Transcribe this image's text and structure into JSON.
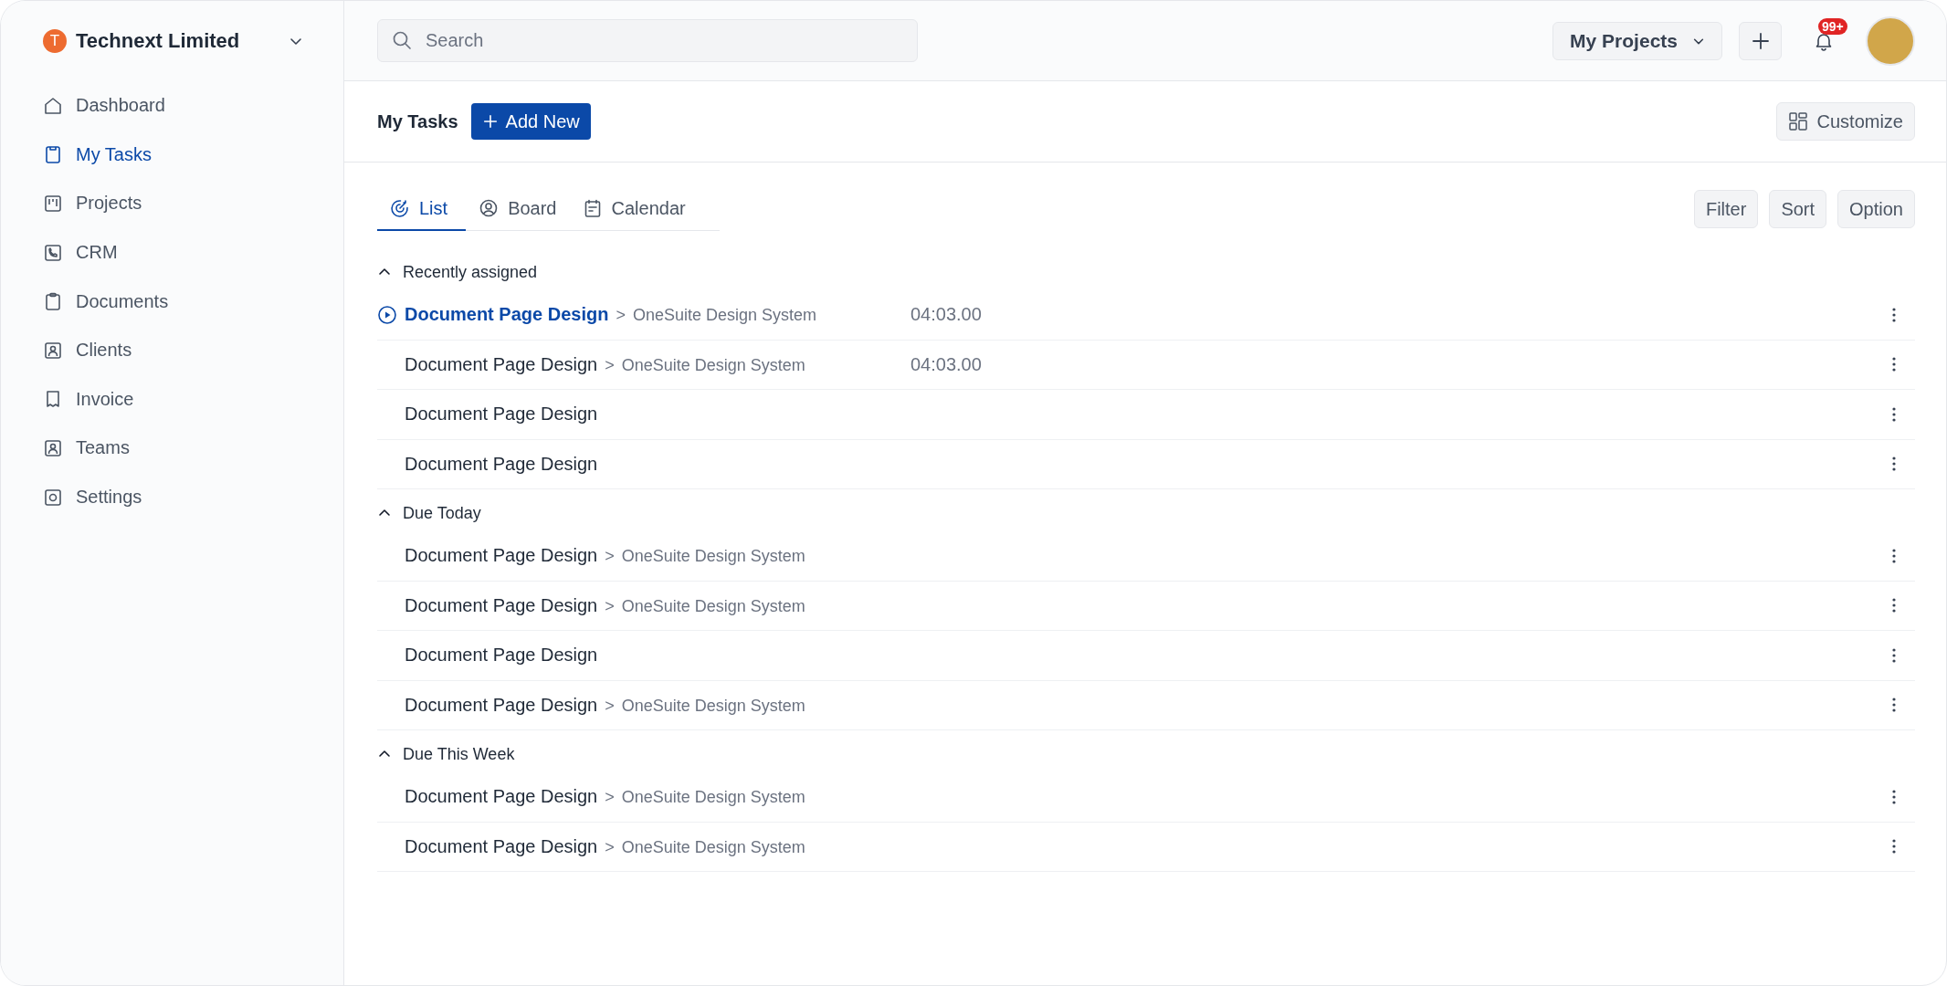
{
  "sidebar": {
    "org": {
      "initial": "T",
      "name": "Technext Limited"
    },
    "items": [
      {
        "label": "Dashboard",
        "selected": false
      },
      {
        "label": "My Tasks",
        "selected": true
      },
      {
        "label": "Projects",
        "selected": false
      },
      {
        "label": "CRM",
        "selected": false
      },
      {
        "label": "Documents",
        "selected": false
      },
      {
        "label": "Clients",
        "selected": false
      },
      {
        "label": "Invoice",
        "selected": false
      },
      {
        "label": "Teams",
        "selected": false
      },
      {
        "label": "Settings",
        "selected": false
      }
    ]
  },
  "topbar": {
    "search": {
      "placeholder": "Search"
    },
    "project_menu": "My Projects",
    "notifications_badge": "99+"
  },
  "header": {
    "title": "My Tasks",
    "add_button": "Add New",
    "customize_button": "Customize"
  },
  "tabs": [
    {
      "label": "List",
      "selected": true
    },
    {
      "label": "Board",
      "selected": false
    },
    {
      "label": "Calendar",
      "selected": false
    }
  ],
  "actions": [
    "Filter",
    "Sort",
    "Option"
  ],
  "sections": [
    {
      "title": "Recently assigned",
      "expanded": true,
      "rows": [
        {
          "title": "Document Page Design",
          "separator": ">",
          "project": "OneSuite Design System",
          "time": "04:03.00",
          "active": true
        },
        {
          "title": "Document Page Design",
          "separator": ">",
          "project": "OneSuite Design System",
          "time": "04:03.00",
          "active": false
        },
        {
          "title": "Document Page Design",
          "active": false
        },
        {
          "title": "Document Page Design",
          "active": false
        }
      ]
    },
    {
      "title": "Due Today",
      "expanded": true,
      "rows": [
        {
          "title": "Document Page Design",
          "separator": ">",
          "project": "OneSuite Design System",
          "active": false
        },
        {
          "title": "Document Page Design",
          "separator": ">",
          "project": "OneSuite Design System",
          "active": false
        },
        {
          "title": "Document Page Design",
          "active": false
        },
        {
          "title": "Document Page Design",
          "separator": ">",
          "project": "OneSuite Design System",
          "active": false
        }
      ]
    },
    {
      "title": "Due This Week",
      "expanded": true,
      "rows": [
        {
          "title": "Document Page Design",
          "separator": ">",
          "project": "OneSuite Design System",
          "active": false
        },
        {
          "title": "Document Page Design",
          "separator": ">",
          "project": "OneSuite Design System",
          "active": false
        }
      ]
    }
  ]
}
